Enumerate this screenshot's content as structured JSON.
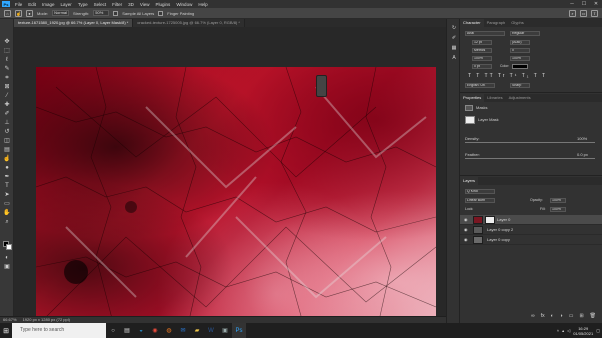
{
  "app": {
    "logo": "Ps"
  },
  "menu": [
    "File",
    "Edit",
    "Image",
    "Layer",
    "Type",
    "Select",
    "Filter",
    "3D",
    "View",
    "Plugins",
    "Window",
    "Help"
  ],
  "window_controls": [
    "─",
    "☐",
    "✕"
  ],
  "options": {
    "mode_label": "Mode:",
    "mode_value": "Normal",
    "opacity_label": "Strength:",
    "opacity_value": "50%",
    "sample_label": "Sample All Layers",
    "finger_label": "Finger Painting"
  },
  "tabs": [
    {
      "label": "texture-1671580_1920.jpg @ 66.7% (Layer 0, Layer Mask/8) *"
    },
    {
      "label": "cracked-texture-1725005.jpg @ 66.7% (Layer 0, RGB/8) *"
    }
  ],
  "status": {
    "zoom": "66.67%",
    "doc": "1920 px x 1280 px (72 ppi)"
  },
  "panels": {
    "character": {
      "tabs": [
        "Character",
        "Paragraph",
        "Glyphs"
      ],
      "font": "Arial",
      "style": "Regular",
      "size": "12 pt",
      "leading": "(Auto)",
      "kerning": "Metrics",
      "tracking": "0",
      "vscale": "100%",
      "hscale": "100%",
      "baseline": "0 pt",
      "color_label": "Color:",
      "language": "English: UK",
      "aa": "Sharp"
    },
    "properties": {
      "tabs": [
        "Properties",
        "Libraries",
        "Adjustments"
      ],
      "section": "Masks",
      "layer_mask_label": "Layer Mask",
      "density_label": "Density:",
      "density_value": "100%",
      "feather_label": "Feather:",
      "feather_value": "0.0 px"
    },
    "layers": {
      "tabs": [
        "Layers"
      ],
      "kind_label": "Q Kind",
      "blend": "Linear Burn",
      "opacity_label": "Opacity:",
      "opacity_value": "100%",
      "lock_label": "Lock:",
      "fill_label": "Fill:",
      "fill_value": "100%",
      "items": [
        {
          "name": "Layer 0",
          "selected": true
        },
        {
          "name": "Layer 0 copy 2",
          "selected": false
        },
        {
          "name": "Layer 0 copy",
          "selected": false
        }
      ]
    }
  },
  "taskbar": {
    "search_placeholder": "Type here to search",
    "time": "16:29",
    "date": "01/05/2021"
  }
}
